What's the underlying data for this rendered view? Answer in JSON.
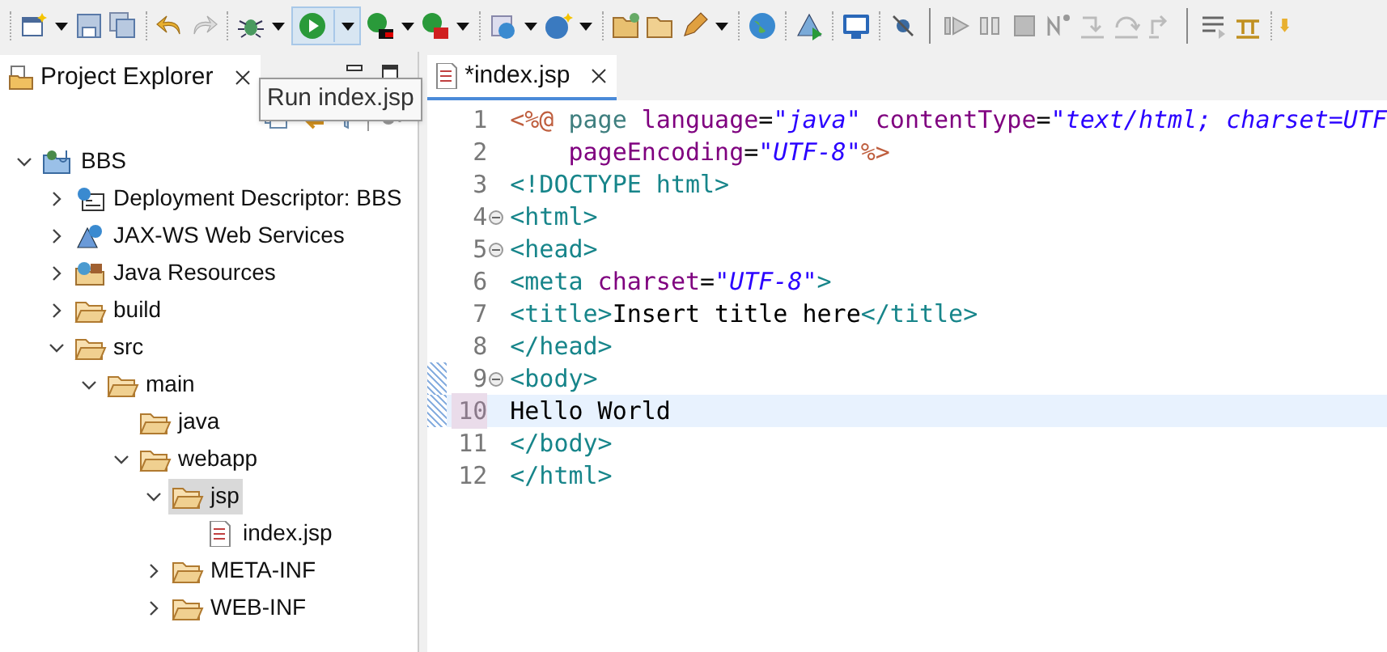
{
  "tooltip": "Run index.jsp",
  "explorer": {
    "title": "Project Explorer",
    "tree": [
      {
        "label": "BBS",
        "kind": "project",
        "expanded": true,
        "selected": false,
        "children": [
          {
            "label": "Deployment Descriptor: BBS",
            "kind": "descriptor",
            "expanded": false,
            "selected": false
          },
          {
            "label": "JAX-WS Web Services",
            "kind": "services",
            "expanded": false,
            "selected": false
          },
          {
            "label": "Java Resources",
            "kind": "resources",
            "expanded": false,
            "selected": false
          },
          {
            "label": "build",
            "kind": "folder",
            "expanded": false,
            "selected": false
          },
          {
            "label": "src",
            "kind": "folder",
            "expanded": true,
            "selected": false,
            "children": [
              {
                "label": "main",
                "kind": "folder",
                "expanded": true,
                "selected": false,
                "children": [
                  {
                    "label": "java",
                    "kind": "folder",
                    "selected": false
                  },
                  {
                    "label": "webapp",
                    "kind": "folder",
                    "expanded": true,
                    "selected": false,
                    "children": [
                      {
                        "label": "jsp",
                        "kind": "folder",
                        "expanded": true,
                        "selected": true,
                        "children": [
                          {
                            "label": "index.jsp",
                            "kind": "file",
                            "selected": false
                          }
                        ]
                      },
                      {
                        "label": "META-INF",
                        "kind": "folder",
                        "expanded": false,
                        "selected": false
                      },
                      {
                        "label": "WEB-INF",
                        "kind": "folder",
                        "expanded": false,
                        "selected": false
                      }
                    ]
                  }
                ]
              }
            ]
          }
        ]
      }
    ]
  },
  "editor": {
    "tab": "*index.jsp",
    "lines": [
      {
        "number": "1",
        "fold": false,
        "current": false,
        "tokens": [
          {
            "kind": "delim",
            "text": "<%@"
          },
          {
            "kind": "directive",
            "text": " page "
          },
          {
            "kind": "attr",
            "text": "language"
          },
          {
            "kind": "text",
            "text": "="
          },
          {
            "kind": "value",
            "text": "\"java\""
          },
          {
            "kind": "attr",
            "text": " contentType"
          },
          {
            "kind": "text",
            "text": "="
          },
          {
            "kind": "value",
            "text": "\"text/html; charset=UTF"
          }
        ]
      },
      {
        "number": "2",
        "fold": false,
        "current": false,
        "tokens": [
          {
            "kind": "attr",
            "text": "    pageEncoding"
          },
          {
            "kind": "text",
            "text": "="
          },
          {
            "kind": "value",
            "text": "\"UTF-8\""
          },
          {
            "kind": "delim",
            "text": "%>"
          }
        ]
      },
      {
        "number": "3",
        "fold": false,
        "current": false,
        "tokens": [
          {
            "kind": "tag",
            "text": "<!DOCTYPE html>"
          }
        ]
      },
      {
        "number": "4",
        "fold": true,
        "current": false,
        "tokens": [
          {
            "kind": "tag",
            "text": "<html>"
          }
        ]
      },
      {
        "number": "5",
        "fold": true,
        "current": false,
        "tokens": [
          {
            "kind": "tag",
            "text": "<head>"
          }
        ]
      },
      {
        "number": "6",
        "fold": false,
        "current": false,
        "tokens": [
          {
            "kind": "tag",
            "text": "<meta"
          },
          {
            "kind": "attr",
            "text": " charset"
          },
          {
            "kind": "text",
            "text": "="
          },
          {
            "kind": "value",
            "text": "\"UTF-8\""
          },
          {
            "kind": "tag",
            "text": ">"
          }
        ]
      },
      {
        "number": "7",
        "fold": false,
        "current": false,
        "tokens": [
          {
            "kind": "tag",
            "text": "<title>"
          },
          {
            "kind": "text",
            "text": "Insert title here"
          },
          {
            "kind": "tag",
            "text": "</title>"
          }
        ]
      },
      {
        "number": "8",
        "fold": false,
        "current": false,
        "tokens": [
          {
            "kind": "tag",
            "text": "</head>"
          }
        ]
      },
      {
        "number": "9",
        "fold": true,
        "current": false,
        "tokens": [
          {
            "kind": "tag",
            "text": "<body>"
          }
        ]
      },
      {
        "number": "10",
        "fold": false,
        "current": true,
        "tokens": [
          {
            "kind": "text",
            "text": "Hello World"
          }
        ]
      },
      {
        "number": "11",
        "fold": false,
        "current": false,
        "tokens": [
          {
            "kind": "tag",
            "text": "</body>"
          }
        ]
      },
      {
        "number": "12",
        "fold": false,
        "current": false,
        "tokens": [
          {
            "kind": "tag",
            "text": "</html>"
          }
        ]
      }
    ]
  }
}
